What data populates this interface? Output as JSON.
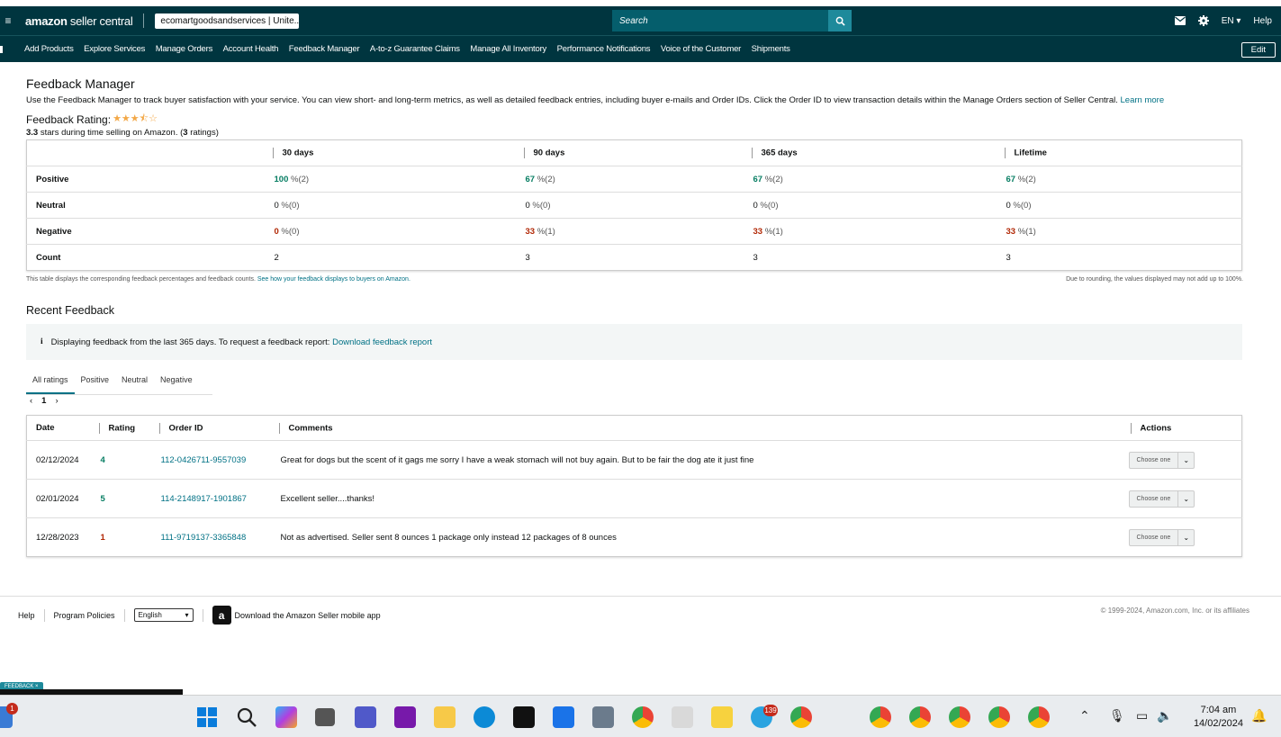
{
  "topbar": {
    "logo_prefix": "amazon",
    "logo_suffix": " seller central",
    "store_name": "ecomartgoodsandservices | Unite...",
    "search_placeholder": "Search",
    "language": "EN",
    "help": "Help"
  },
  "nav": {
    "items": [
      "Add Products",
      "Explore Services",
      "Manage Orders",
      "Account Health",
      "Feedback Manager",
      "A-to-z Guarantee Claims",
      "Manage All Inventory",
      "Performance Notifications",
      "Voice of the Customer",
      "Shipments"
    ],
    "edit": "Edit"
  },
  "page": {
    "title": "Feedback Manager",
    "description": "Use the Feedback Manager to track buyer satisfaction with your service. You can view short- and long-term metrics, as well as detailed feedback entries, including buyer e-mails and Order IDs. Click the Order ID to view transaction details within the Manage Orders section of Seller Central.",
    "learn_more": "Learn more",
    "rating_label": "Feedback Rating:",
    "rating_stars": 3.5,
    "rating_value": "3.3",
    "rating_sub_mid": " stars during time selling on Amazon. (",
    "rating_count": "3",
    "rating_sub_end": " ratings)"
  },
  "summary_table": {
    "columns": [
      "30 days",
      "90 days",
      "365 days",
      "Lifetime"
    ],
    "rows": [
      {
        "label": "Positive",
        "cells": [
          {
            "pct": "100",
            "count": " %(2)"
          },
          {
            "pct": "67",
            "count": " %(2)"
          },
          {
            "pct": "67",
            "count": " %(2)"
          },
          {
            "pct": "67",
            "count": " %(2)"
          }
        ]
      },
      {
        "label": "Neutral",
        "cells": [
          {
            "pct": "0",
            "count": " %(0)"
          },
          {
            "pct": "0",
            "count": " %(0)"
          },
          {
            "pct": "0",
            "count": " %(0)"
          },
          {
            "pct": "0",
            "count": " %(0)"
          }
        ]
      },
      {
        "label": "Negative",
        "cells": [
          {
            "pct": "0",
            "count": " %(0)"
          },
          {
            "pct": "33",
            "count": " %(1)"
          },
          {
            "pct": "33",
            "count": " %(1)"
          },
          {
            "pct": "33",
            "count": " %(1)"
          }
        ]
      },
      {
        "label": "Count",
        "cells": [
          {
            "pct": "2",
            "count": ""
          },
          {
            "pct": "3",
            "count": ""
          },
          {
            "pct": "3",
            "count": ""
          },
          {
            "pct": "3",
            "count": ""
          }
        ]
      }
    ],
    "footnote": "This table displays the corresponding feedback percentages and feedback counts.",
    "footnote_link": "See how your feedback displays to buyers on Amazon.",
    "rounding_note": "Due to rounding, the values displayed may not add up to 100%."
  },
  "recent": {
    "title": "Recent Feedback",
    "info_text": "Displaying feedback from the last 365 days. To request a feedback report:",
    "info_link": "Download feedback report",
    "tabs": [
      "All ratings",
      "Positive",
      "Neutral",
      "Negative"
    ],
    "page": "1",
    "columns": [
      "Date",
      "Rating",
      "Order ID",
      "Comments",
      "Actions"
    ],
    "rows": [
      {
        "date": "02/12/2024",
        "rating": "4",
        "order_id": "112-0426711-9557039",
        "comment": "Great for dogs but the scent of it gags me sorry I have a weak stomach will not buy again. But to be fair the dog ate it just fine",
        "action": "Choose one"
      },
      {
        "date": "02/01/2024",
        "rating": "5",
        "order_id": "114-2148917-1901867",
        "comment": "Excellent seller....thanks!",
        "action": "Choose one"
      },
      {
        "date": "12/28/2023",
        "rating": "1",
        "order_id": "111-9719137-3365848",
        "comment": "Not as advertised. Seller sent 8 ounces 1 package only instead 12 packages of 8 ounces",
        "action": "Choose one"
      }
    ]
  },
  "footer": {
    "help": "Help",
    "program_policies": "Program Policies",
    "language": "English",
    "app_text": "Download the Amazon Seller mobile app",
    "copyright": "© 1999-2024, Amazon.com, Inc. or its affiliates",
    "feedback_tab": "FEEDBACK ×"
  },
  "taskbar": {
    "time": "7:04 am",
    "date": "14/02/2024",
    "notif_count": "1",
    "telegram_count": "139"
  },
  "colors": {
    "topbar": "#00353f",
    "link": "#007185",
    "positive": "#067d62",
    "negative": "#b12704",
    "star": "#f3a847"
  }
}
